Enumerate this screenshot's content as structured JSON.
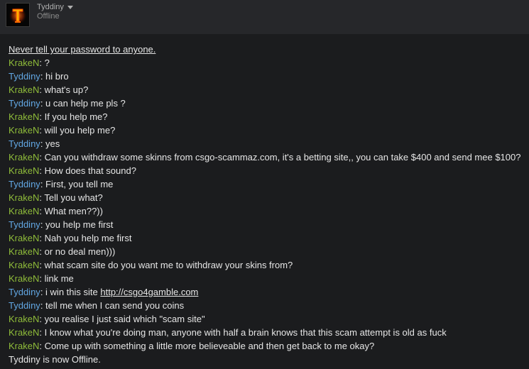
{
  "header": {
    "username": "Tyddiny",
    "status": "Offline",
    "accent": "#ff6a00"
  },
  "chat": {
    "warning": "Never tell your password to anyone.",
    "messages": [
      {
        "sender": "KrakeN",
        "role": "friend",
        "text": "?"
      },
      {
        "sender": "Tyddiny",
        "role": "self",
        "text": "hi bro"
      },
      {
        "sender": "KrakeN",
        "role": "friend",
        "text": "what's up?"
      },
      {
        "sender": "Tyddiny",
        "role": "self",
        "text": "u can help me pls ?"
      },
      {
        "sender": "KrakeN",
        "role": "friend",
        "text": "If you help me?"
      },
      {
        "sender": "KrakeN",
        "role": "friend",
        "text": "will you help me?"
      },
      {
        "sender": "Tyddiny",
        "role": "self",
        "text": "yes"
      },
      {
        "sender": "KrakeN",
        "role": "friend",
        "text": "Can you withdraw some skinns from csgo-scammaz.com, it's a betting site,, you can take $400 and send mee $100?"
      },
      {
        "sender": "KrakeN",
        "role": "friend",
        "text": "How does that sound?"
      },
      {
        "sender": "Tyddiny",
        "role": "self",
        "text": "First, you tell me"
      },
      {
        "sender": "KrakeN",
        "role": "friend",
        "text": "Tell you what?"
      },
      {
        "sender": "KrakeN",
        "role": "friend",
        "text": "What men??))"
      },
      {
        "sender": "Tyddiny",
        "role": "self",
        "text": "you help me first"
      },
      {
        "sender": "KrakeN",
        "role": "friend",
        "text": "Nah you help me first"
      },
      {
        "sender": "KrakeN",
        "role": "friend",
        "text": "or no deal men)))"
      },
      {
        "sender": "KrakeN",
        "role": "friend",
        "text": "what scam site do you want me to withdraw your skins from?"
      },
      {
        "sender": "KrakeN",
        "role": "friend",
        "text": "link me"
      },
      {
        "sender": "Tyddiny",
        "role": "self",
        "text": "i win this site ",
        "link": "http://csgo4gamble.com"
      },
      {
        "sender": "Tyddiny",
        "role": "self",
        "text": "tell me when I can send you coins"
      },
      {
        "sender": "KrakeN",
        "role": "friend",
        "text": "you realise I just said which \"scam site\""
      },
      {
        "sender": "KrakeN",
        "role": "friend",
        "text": "I know what you're doing man, anyone with half a brain knows that this scam attempt is old as fuck"
      },
      {
        "sender": "KrakeN",
        "role": "friend",
        "text": "Come up with something a little more believeable and then get back to me okay?"
      }
    ],
    "separator": ": ",
    "system_message": "Tyddiny is now Offline."
  }
}
